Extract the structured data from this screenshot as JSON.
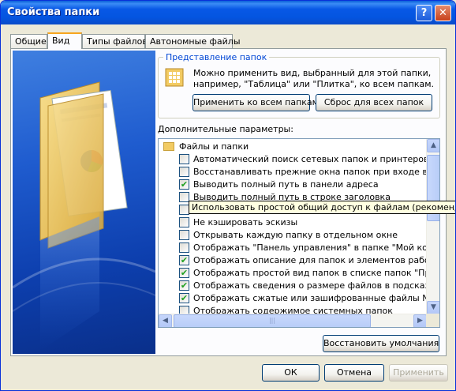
{
  "window": {
    "title": "Свойства папки",
    "help_glyph": "?",
    "close_glyph": "✕"
  },
  "tabs": [
    {
      "label": "Общие"
    },
    {
      "label": "Вид"
    },
    {
      "label": "Типы файлов"
    },
    {
      "label": "Автономные файлы"
    }
  ],
  "folder_views": {
    "title": "Представление папок",
    "description": "Можно применить вид, выбранный для этой папки, например, \"Таблица\" или \"Плитка\", ко всем папкам.",
    "apply_all": "Применить ко всем папкам",
    "reset_all": "Сброс для всех папок"
  },
  "advanced": {
    "label": "Дополнительные параметры:",
    "root": "Файлы и папки",
    "items": [
      {
        "text": "Автоматический поиск сетевых папок и принтеров",
        "checked": false
      },
      {
        "text": "Восстанавливать прежние окна папок при входе в систему",
        "checked": false
      },
      {
        "text": "Выводить полный путь в панели адреса",
        "checked": true
      },
      {
        "text": "Выводить полный путь в строке заголовка",
        "checked": false
      },
      {
        "text": "Использовать простой общий доступ к файлам (рекомендуется)",
        "checked": false
      },
      {
        "text": "Не кэшировать эскизы",
        "checked": false
      },
      {
        "text": "Открывать каждую папку в отдельном окне",
        "checked": false
      },
      {
        "text": "Отображать \"Панель управления\" в папке \"Мой компьютер\"",
        "checked": false
      },
      {
        "text": "Отображать описание для папок и элементов рабочего стола",
        "checked": true
      },
      {
        "text": "Отображать простой вид папок в списке папок \"Проводника\"",
        "checked": true
      },
      {
        "text": "Отображать сведения о размере файлов в подсказках папок",
        "checked": true
      },
      {
        "text": "Отображать сжатые или зашифрованные файлы NTFS другим цветом",
        "checked": true
      },
      {
        "text": "Отображать содержимое системных папок",
        "checked": false
      }
    ],
    "tooltip": "Использовать простой общий доступ к файлам (рекомендуется)",
    "scroll_up": "▲",
    "scroll_down": "▼",
    "scroll_left": "◀",
    "scroll_right": "▶",
    "thumb_grip": "|||"
  },
  "restore_defaults": "Восстановить умолчания",
  "footer": {
    "ok": "ОК",
    "cancel": "Отмена",
    "apply": "Применить"
  },
  "check_glyph": "✔",
  "colors": {
    "accent": "#0046d5",
    "titlebar": "#0858e6",
    "tab_highlight": "#f7a51f"
  }
}
